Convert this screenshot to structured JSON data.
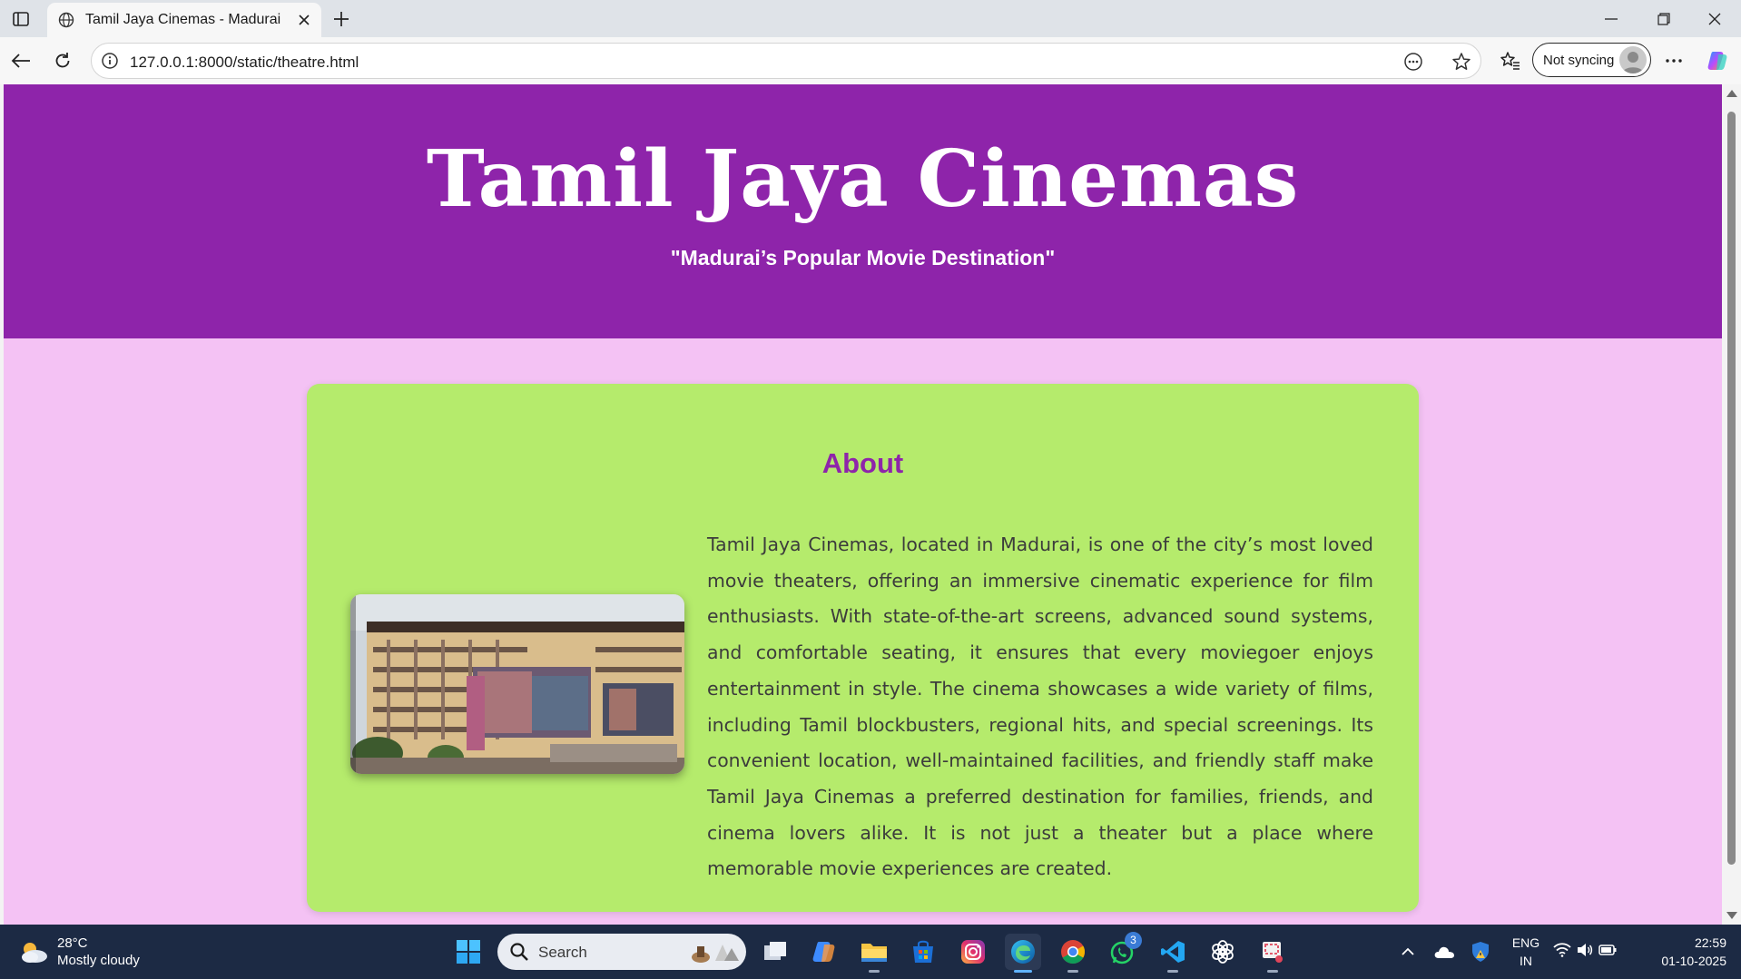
{
  "browser": {
    "tab_title": "Tamil Jaya Cinemas - Madurai",
    "url": "127.0.0.1:8000/static/theatre.html",
    "sync_label": "Not syncing"
  },
  "page": {
    "hero_title": "Tamil Jaya Cinemas",
    "hero_subtitle": "\"Madurai’s Popular Movie Destination\"",
    "about_heading": "About",
    "about_text": "Tamil Jaya Cinemas, located in Madurai, is one of the city’s most loved movie theaters, offering an immersive cinematic experience for film enthusiasts. With state-of-the-art screens, advanced sound systems, and comfortable seating, it ensures that every moviegoer enjoys entertainment in style. The cinema showcases a wide variety of films, including Tamil blockbusters, regional hits, and special screenings. Its convenient location, well-maintained facilities, and friendly staff make Tamil Jaya Cinemas a preferred destination for families, friends, and cinema lovers alike. It is not just a theater but a place where memorable movie experiences are created.",
    "colors": {
      "hero_bg": "#8e24aa",
      "page_bg": "#f4c2f4",
      "card_bg": "#b5eb6c",
      "heading": "#8e24aa"
    }
  },
  "taskbar": {
    "weather_temp": "28°C",
    "weather_desc": "Mostly cloudy",
    "search_label": "Search",
    "whatsapp_badge": "3",
    "lang_top": "ENG",
    "lang_bottom": "IN",
    "time": "22:59",
    "date": "01-10-2025"
  }
}
